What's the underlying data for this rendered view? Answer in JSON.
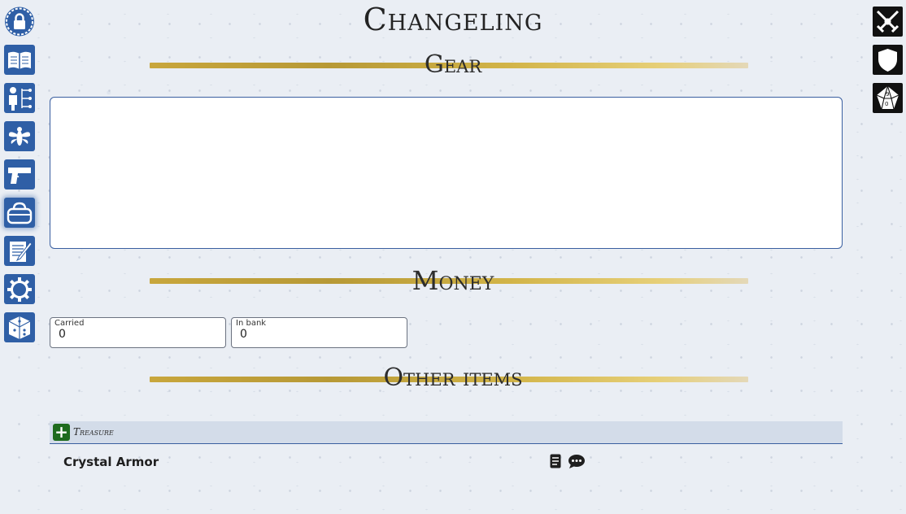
{
  "title": "Changeling",
  "sections": {
    "gear": "Gear",
    "money": "Money",
    "other_items": "Other items"
  },
  "gear_notes": {
    "value": ""
  },
  "money": {
    "carried_label": "Carried",
    "carried_value": "0",
    "bank_label": "In bank",
    "bank_value": "0"
  },
  "treasure": {
    "add_label": "+",
    "label": "Treasure",
    "items": [
      {
        "name": "Crystal Armor"
      }
    ]
  },
  "left_nav": [
    "lock-icon",
    "book-icon",
    "character-tree-icon",
    "wasp-icon",
    "pistol-icon",
    "bag-icon",
    "notes-icon",
    "gear-icon",
    "dice-icon"
  ],
  "right_nav": [
    "crossed-swords-icon",
    "shield-icon",
    "d10-dice-icon"
  ],
  "colors": {
    "nav_blue": "#2f5fa6",
    "divider_gold": "#c8a63c",
    "add_green": "#1e6b1e",
    "background": "#eaeef4"
  }
}
